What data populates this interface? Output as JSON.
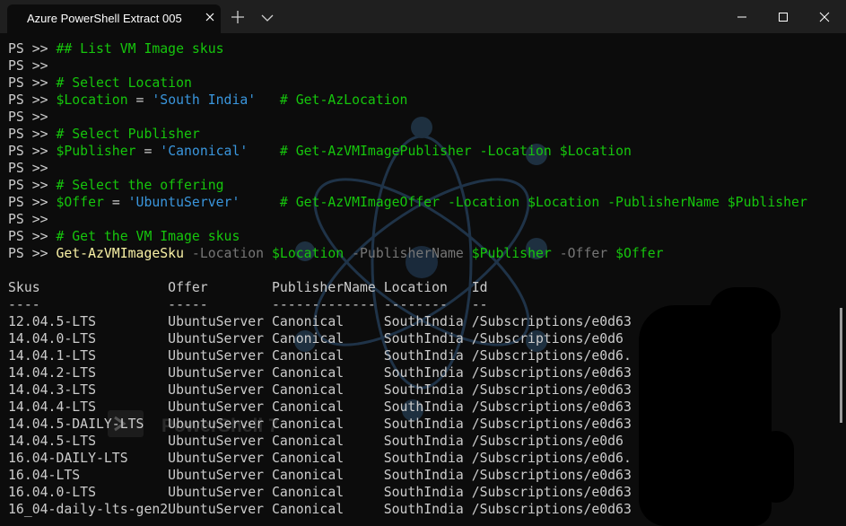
{
  "window": {
    "tab_title": "Azure PowerShell Extract 005"
  },
  "icons": {
    "tab_close": "close-icon",
    "new_tab": "plus-icon",
    "tab_dropdown": "chevron-down-icon",
    "minimize": "minimize-icon",
    "maximize": "maximize-icon",
    "close": "close-icon"
  },
  "colors": {
    "background": "#0c0c0c",
    "titlebar": "#1f1f1f",
    "comment": "#16c60c",
    "variable": "#16c60c",
    "string": "#3a96dd",
    "command": "#f9f1a5",
    "parameter": "#767676",
    "text": "#cccccc"
  },
  "background_watermark": "PowerShell 7",
  "terminal": {
    "prompt": "PS >> ",
    "lines": [
      {
        "parts": [
          {
            "t": "## List VM Image skus",
            "c": "cm"
          }
        ]
      },
      {
        "parts": []
      },
      {
        "parts": [
          {
            "t": "# Select Location",
            "c": "cm"
          }
        ]
      },
      {
        "parts": [
          {
            "t": "$Location",
            "c": "var"
          },
          {
            "t": " = ",
            "c": "op"
          },
          {
            "t": "'South India'",
            "c": "str"
          },
          {
            "t": "   # Get-AzLocation",
            "c": "cm"
          }
        ]
      },
      {
        "parts": []
      },
      {
        "parts": [
          {
            "t": "# Select Publisher",
            "c": "cm"
          }
        ]
      },
      {
        "parts": [
          {
            "t": "$Publisher",
            "c": "var"
          },
          {
            "t": " = ",
            "c": "op"
          },
          {
            "t": "'Canonical'",
            "c": "str"
          },
          {
            "t": "    # Get-AzVMImagePublisher -Location $Location",
            "c": "cm"
          }
        ]
      },
      {
        "parts": []
      },
      {
        "parts": [
          {
            "t": "# Select the offering",
            "c": "cm"
          }
        ]
      },
      {
        "parts": [
          {
            "t": "$Offer",
            "c": "var"
          },
          {
            "t": " = ",
            "c": "op"
          },
          {
            "t": "'UbuntuServer'",
            "c": "str"
          },
          {
            "t": "     # Get-AzVMImageOffer -Location $Location -PublisherName $Publisher",
            "c": "cm"
          }
        ]
      },
      {
        "parts": []
      },
      {
        "parts": [
          {
            "t": "# Get the VM Image skus",
            "c": "cm"
          }
        ]
      },
      {
        "parts": [
          {
            "t": "Get-AzVMImageSku",
            "c": "cmd"
          },
          {
            "t": " -Location ",
            "c": "par"
          },
          {
            "t": "$Location",
            "c": "var"
          },
          {
            "t": " -PublisherName ",
            "c": "par"
          },
          {
            "t": "$Publisher",
            "c": "var"
          },
          {
            "t": " -Offer ",
            "c": "par"
          },
          {
            "t": "$Offer",
            "c": "var"
          }
        ]
      }
    ],
    "table": {
      "headers": [
        "Skus",
        "Offer",
        "PublisherName",
        "Location",
        "Id"
      ],
      "underline": "----                -----        ------------- --------   --",
      "rows": [
        [
          "12.04.5-LTS",
          "UbuntuServer",
          "Canonical",
          "SouthIndia",
          "/Subscriptions/e0d63"
        ],
        [
          "14.04.0-LTS",
          "UbuntuServer",
          "Canonical",
          "SouthIndia",
          "/Subscriptions/e0d6"
        ],
        [
          "14.04.1-LTS",
          "UbuntuServer",
          "Canonical",
          "SouthIndia",
          "/Subscriptions/e0d6."
        ],
        [
          "14.04.2-LTS",
          "UbuntuServer",
          "Canonical",
          "SouthIndia",
          "/Subscriptions/e0d63"
        ],
        [
          "14.04.3-LTS",
          "UbuntuServer",
          "Canonical",
          "SouthIndia",
          "/Subscriptions/e0d63"
        ],
        [
          "14.04.4-LTS",
          "UbuntuServer",
          "Canonical",
          "SouthIndia",
          "/Subscriptions/e0d63"
        ],
        [
          "14.04.5-DAILY-LTS",
          "UbuntuServer",
          "Canonical",
          "SouthIndia",
          "/Subscriptions/e0d63"
        ],
        [
          "14.04.5-LTS",
          "UbuntuServer",
          "Canonical",
          "SouthIndia",
          "/Subscriptions/e0d6"
        ],
        [
          "16.04-DAILY-LTS",
          "UbuntuServer",
          "Canonical",
          "SouthIndia",
          "/Subscriptions/e0d6."
        ],
        [
          "16.04-LTS",
          "UbuntuServer",
          "Canonical",
          "SouthIndia",
          "/Subscriptions/e0d63"
        ],
        [
          "16.04.0-LTS",
          "UbuntuServer",
          "Canonical",
          "SouthIndia",
          "/Subscriptions/e0d63"
        ],
        [
          "16_04-daily-lts-gen2",
          "UbuntuServer",
          "Canonical",
          "SouthIndia",
          "/Subscriptions/e0d63"
        ]
      ]
    }
  }
}
